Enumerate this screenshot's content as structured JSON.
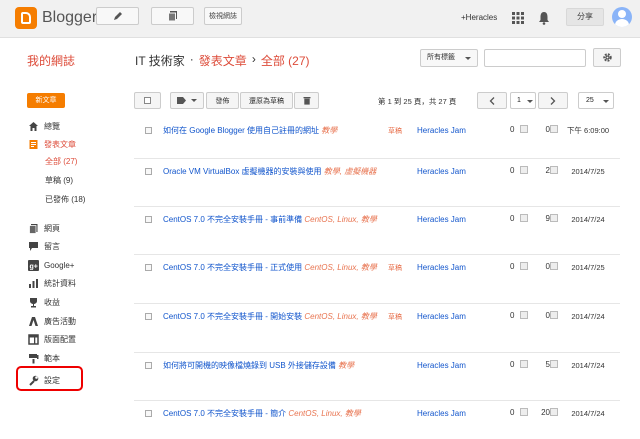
{
  "app": {
    "brand": "Blogger",
    "view_blog": "檢視網誌",
    "user": "+Heracles",
    "share": "分享"
  },
  "header": {
    "blog_name": "我的網誌",
    "crumb_blog": "IT 技術家",
    "sep1": "·",
    "crumb_section": "發表文章",
    "sep2": "›",
    "crumb_filter": "全部 (27)",
    "label_filter": "所有標籤"
  },
  "sidebar": {
    "new_post": "新文章",
    "items": [
      {
        "label": "總覽",
        "icon": "home-icon"
      },
      {
        "label": "發表文章",
        "icon": "posts-icon"
      },
      {
        "label": "網頁",
        "icon": "pages-icon"
      },
      {
        "label": "留言",
        "icon": "comments-icon"
      },
      {
        "label": "Google+",
        "icon": "googleplus-icon"
      },
      {
        "label": "統計資料",
        "icon": "stats-icon"
      },
      {
        "label": "收益",
        "icon": "earnings-icon"
      },
      {
        "label": "廣告活動",
        "icon": "campaigns-icon"
      },
      {
        "label": "版面配置",
        "icon": "layout-icon"
      },
      {
        "label": "範本",
        "icon": "template-icon"
      },
      {
        "label": "設定",
        "icon": "settings-icon"
      }
    ],
    "sub_items": [
      "全部 (27)",
      "草稿 (9)",
      "已發佈 (18)"
    ]
  },
  "toolbar": {
    "publish": "發佈",
    "revert": "還原為草稿",
    "count": "第 1 到 25 頁，共 27 頁",
    "page": "1",
    "per_page": "25"
  },
  "posts": [
    {
      "title": "如何在 Google Blogger 使用自己註冊的網址",
      "labels": "教學",
      "status": "草稿",
      "author": "Heracles Jam",
      "comments": "0",
      "views": "0",
      "date": "下午 6:09:00"
    },
    {
      "title": "Oracle VM VirtualBox 虛擬機器的安裝與使用",
      "labels": "教學, 虛擬機器",
      "status": "",
      "author": "Heracles Jam",
      "comments": "0",
      "views": "2",
      "date": "2014/7/25"
    },
    {
      "title": "CentOS 7.0 不完全安裝手冊 - 事前準備",
      "labels": "CentOS, Linux, 教學",
      "status": "",
      "author": "Heracles Jam",
      "comments": "0",
      "views": "9",
      "date": "2014/7/24"
    },
    {
      "title": "CentOS 7.0 不完全安裝手冊 - 正式使用",
      "labels": "CentOS, Linux, 教學",
      "status": "草稿",
      "author": "Heracles Jam",
      "comments": "0",
      "views": "0",
      "date": "2014/7/25"
    },
    {
      "title": "CentOS 7.0 不完全安裝手冊 - 開始安裝",
      "labels": "CentOS, Linux, 教學",
      "status": "草稿",
      "author": "Heracles Jam",
      "comments": "0",
      "views": "0",
      "date": "2014/7/24"
    },
    {
      "title": "如何將可開機的映像檔燒錄到 USB 外接儲存設備",
      "labels": "教學",
      "status": "",
      "author": "Heracles Jam",
      "comments": "0",
      "views": "5",
      "date": "2014/7/24"
    },
    {
      "title": "CentOS 7.0 不完全安裝手冊 - 簡介",
      "labels": "CentOS, Linux, 教學",
      "status": "",
      "author": "Heracles Jam",
      "comments": "0",
      "views": "20",
      "date": "2014/7/24"
    }
  ]
}
